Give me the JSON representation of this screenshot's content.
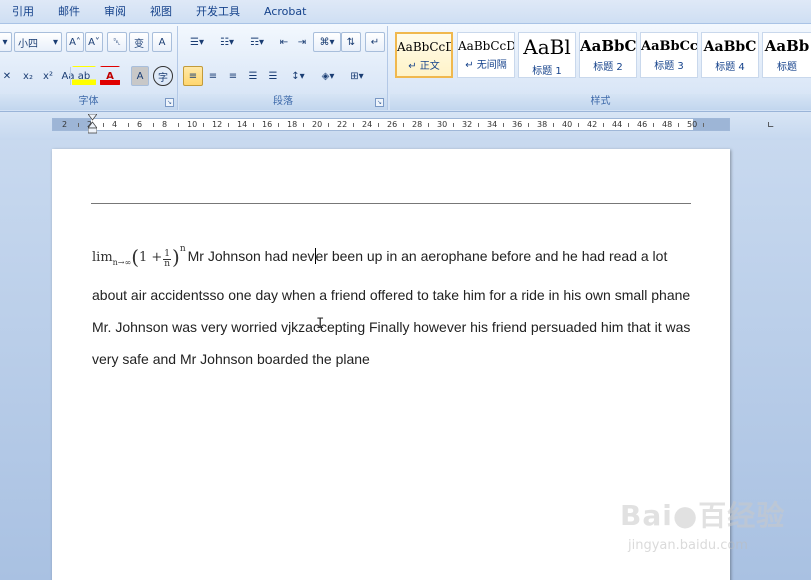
{
  "menu": {
    "tabs": [
      "引用",
      "邮件",
      "审阅",
      "视图",
      "开发工具",
      "Acrobat"
    ]
  },
  "ribbon": {
    "font_group": {
      "label": "字体",
      "font_size_value": "小四",
      "grow_font": "A˄",
      "shrink_font": "A˅",
      "clear_format": "␡",
      "phonetic": "变",
      "char_border": "A",
      "subscript": "x₂",
      "superscript": "x²",
      "change_case": "Aa",
      "highlight": "ab",
      "font_color": "A",
      "char_shading": "A",
      "enclose_char": "字"
    },
    "paragraph_group": {
      "label": "段落"
    },
    "styles_group": {
      "label": "样式",
      "styles": [
        {
          "sample": "AaBbCcD",
          "name": "↵ 正文"
        },
        {
          "sample": "AaBbCcD",
          "name": "↵ 无间隔"
        },
        {
          "sample": "AaBl",
          "name": "标题 1"
        },
        {
          "sample": "AaBbC",
          "name": "标题 2"
        },
        {
          "sample": "AaBbCc",
          "name": "标题 3"
        },
        {
          "sample": "AaBbC",
          "name": "标题 4"
        },
        {
          "sample": "AaBb",
          "name": "标题"
        }
      ]
    }
  },
  "ruler": {
    "labels": [
      "2",
      "2",
      "4",
      "6",
      "8",
      "10",
      "12",
      "14",
      "16",
      "18",
      "20",
      "22",
      "24",
      "26",
      "28",
      "30",
      "32",
      "34",
      "36",
      "38",
      "40",
      "42",
      "44",
      "46",
      "48",
      "50"
    ]
  },
  "document": {
    "formula": {
      "lim": "lim",
      "lim_sub": "n→∞",
      "one_plus": "1 +",
      "frac_num": "1",
      "frac_den": "n",
      "exponent": "n"
    },
    "text_before_caret": "Mr Johnson had nev",
    "text_after_caret": "er been up in an aerophane before and he had read a lot about air accidentsso one day when a friend offered to take him for a ride in his own small phane Mr. Johnson was very worried vjkzaccepting Finally however  his friend persuaded him that it was very safe  and Mr Johnson boarded the plane"
  },
  "watermark": {
    "main": "Bai●百经验",
    "sub": "jingyan.baidu.com"
  }
}
